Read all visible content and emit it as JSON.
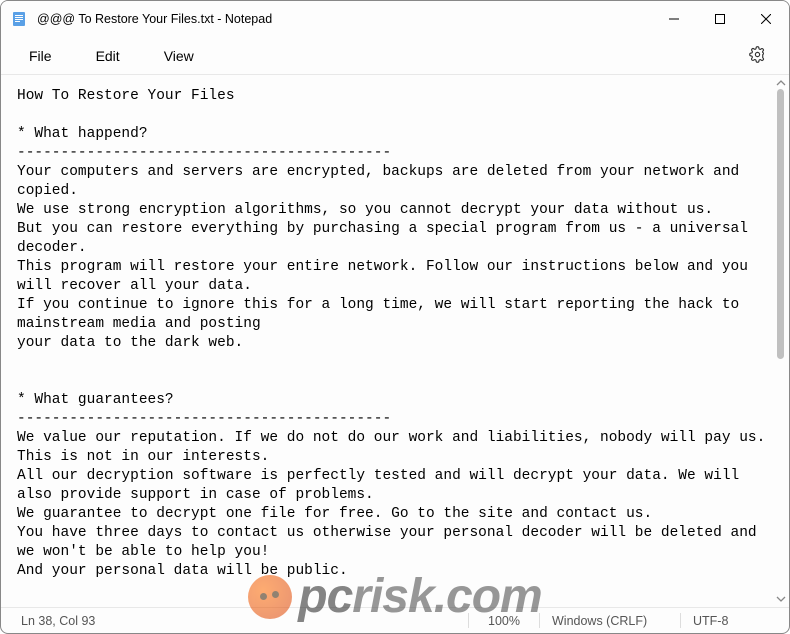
{
  "title": "@@@ To Restore Your Files.txt - Notepad",
  "menu": {
    "file": "File",
    "edit": "Edit",
    "view": "View"
  },
  "body_lines": [
    "How To Restore Your Files",
    "",
    "* What happend?",
    "-------------------------------------------",
    "Your computers and servers are encrypted, backups are deleted from your network and copied.",
    "We use strong encryption algorithms, so you cannot decrypt your data without us.",
    "But you can restore everything by purchasing a special program from us - a universal decoder.",
    "This program will restore your entire network. Follow our instructions below and you will recover all your data.",
    "If you continue to ignore this for a long time, we will start reporting the hack to mainstream media and posting",
    "your data to the dark web.",
    "",
    "",
    "* What guarantees?",
    "-------------------------------------------",
    "We value our reputation. If we do not do our work and liabilities, nobody will pay us. This is not in our interests.",
    "All our decryption software is perfectly tested and will decrypt your data. We will also provide support in case of problems.",
    "We guarantee to decrypt one file for free. Go to the site and contact us.",
    "You have three days to contact us otherwise your personal decoder will be deleted and we won't be able to help you!",
    "And your personal data will be public."
  ],
  "status": {
    "pos": "Ln 38, Col 93",
    "zoom": "100%",
    "eol": "Windows (CRLF)",
    "enc": "UTF-8"
  },
  "watermark": "pcrisk.com"
}
